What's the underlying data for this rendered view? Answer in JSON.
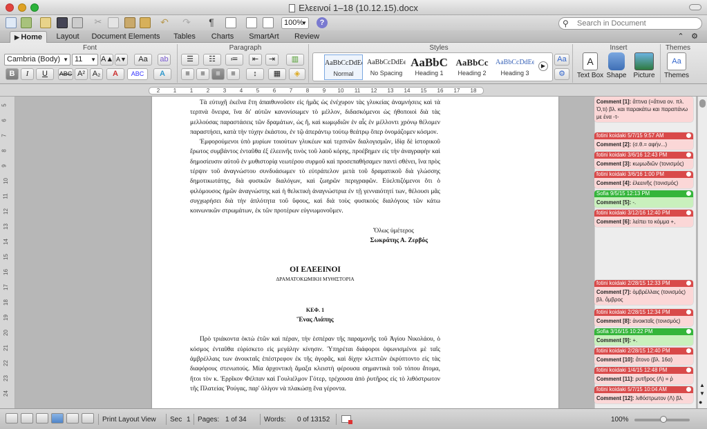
{
  "window": {
    "title": "Ελεεινοί 1–18 (10.12.15).docx"
  },
  "toolbar": {
    "zoom": "100%",
    "search_placeholder": "Search in Document",
    "help": "?"
  },
  "tabs": [
    "Home",
    "Layout",
    "Document Elements",
    "Tables",
    "Charts",
    "SmartArt",
    "Review"
  ],
  "ribbon": {
    "groups": {
      "font": "Font",
      "paragraph": "Paragraph",
      "styles": "Styles",
      "insert": "Insert",
      "themes": "Themes"
    },
    "font_name": "Cambria (Body)",
    "font_size": "11",
    "styles": [
      {
        "preview": "AaBbCcDdEe",
        "label": "Normal"
      },
      {
        "preview": "AaBbCcDdEe",
        "label": "No Spacing"
      },
      {
        "preview": "AaBbC",
        "label": "Heading 1"
      },
      {
        "preview": "AaBbCc",
        "label": "Heading 2"
      },
      {
        "preview": "AaBbCcDdEe",
        "label": "Heading 3"
      }
    ],
    "insert": {
      "text_box": "Text Box",
      "shape": "Shape",
      "picture": "Picture"
    },
    "themes_label": "Themes"
  },
  "ruler": {
    "numbers": [
      "2",
      "1",
      "1",
      "2",
      "3",
      "4",
      "5",
      "6",
      "7",
      "8",
      "9",
      "10",
      "11",
      "12",
      "13",
      "14",
      "15",
      "16",
      "17",
      "18"
    ]
  },
  "vruler": {
    "numbers": [
      "5",
      "6",
      "7",
      "8",
      "9",
      "10",
      "11",
      "12",
      "13",
      "14",
      "15",
      "16",
      "17",
      "18",
      "19",
      "20",
      "21",
      "22",
      "23",
      "24"
    ]
  },
  "document": {
    "p1": "Τὰ εὐτυχῆ ἐκεῖνα ἔτη ἀπαιθυνοῦσιν εἰς ἡμᾶς ὡς ἐνέχυρον τὰς γλυκείας ἀναμνήσεις καὶ τὰ τερπνὰ ὄνειρα, ἵνα δι' αὐτῶν κανονίσωμεν τὸ μέλλον, διδασκόμενοι ὡς ἠθοποιοὶ διὰ τὰς μελλούσας παραστάσεις τῶν δραμάτων, ὡς ἤ, καὶ κωμῳδιῶν ἐν αἷς ἐν μέλλοντι χρόνῳ θέλομεν παραστήσει, κατὰ τὴν τύχην ἑκάστου, ἐν τῷ ἀπεράντῳ τούτῳ θεάτρῳ ὅπερ ὀνομάζομεν κόσμον.",
    "p2": "Ἐμφορούμενοι ὑπὸ μυρίων τοιούτων γλυκέων καὶ τερπνῶν διαλογισμῶν, ἰδίᾳ δὲ ἱστορικοῦ ἔρωτος συμβάντος ἐνταῦθα ἐξ ἐλεεινῆς τινὸς τοῦ λαοῦ κόρης, προέβημεν εἰς τὴν ἀναγραφὴν καὶ δημοσίευσιν αὐτοῦ ἐν μυθιστορίᾳ νεωτέρου συρμοῦ καὶ προσεπαθήσαμεν παντὶ σθένει, ἵνα πρὸς τέρψιν τοῦ ἀναγνώστου συνδυάσωμεν τὸ εὐτράπελον μετὰ τοῦ δραματικοῦ διὰ γλώσσης δημοτικωτάτης, διὰ φυσικῶν διαλόγων, καὶ ζωηρῶν περιγραφῶν. Εὐελπιζόμενοι ὅτι ὁ φιλόμουσος ἡμῶν ἀναγνώστης καὶ ἡ θελκτικὴ ἀναγνώστρια ἐν τῇ γενναιότητί των, θέλουσι μᾶς συγχωρήσει διὰ τὴν ἀπλότητα τοῦ ὕφους, καὶ διὰ τοὺς φυσικοὺς διαλόγους τῶν κάτω κοινωνικῶν στρωμάτων, ἐκ τῶν προτέρων εὐγνωμονοῦμεν.",
    "closing": "Ὅλως ὑμέτερος",
    "author": "Σωκράτης Α. Ζερβός",
    "book_title": "ΟΙ ΕΛΕΕΙΝΟΙ",
    "subtitle": "ΔΡΑΜΑΤΟΚΩΜΙΚΗ ΜΥΘΙΣΤΟΡΙΑ",
    "chapter": "ΚΕΦ. 1",
    "chapter_title": "Ἕνας Λιάπης",
    "p3": "Πρὸ τριάκοντα ὀκτὼ ἐτῶν καὶ πέραν, τὴν ἑσπέραν τῆς παραμονῆς τοῦ Ἁγίου Νικολάου, ὁ κόσμος ἐνταῦθα εὑρίσκετο εἰς μεγάλην κίνησιν. Ὑπηρέται διάφοροι ὀψωνισμένοι μὲ ταῖς ἀμβρέλλαις των ἀνοικταῖς ἐπέστρεφον ἐκ τῆς ἀγορᾶς, καὶ δίχην κλεπτῶν ἐκρύπτοντο εἰς τὰς διαφόρους στενωπούς. Μία ἀρχοντικὴ ἅμαξα κλειστὴ φέρουσα σημαντικὰ τοῦ τόπου ἄτομα, ἤτοι τὸν κ. Ἐρρῖκον Φέλπαν καὶ Γουλιέλμον Γότερ, τρέχουσα ἀπὸ ῥυτῆρος εἰς τὸ λιθόστρωτον τῆς Πλατείας Ῥούγας, παρ' ὀλίγον νὰ πλακώσῃ ἕνα γέροντα."
  },
  "comments": [
    {
      "author": "",
      "label": "Comment [1]:",
      "text": "ἄττινα (=ἅτινα ον. πλ. Ὁ,τι) βλ. και παρακάτω και παραπάνω με ένα -τ-",
      "color": "red"
    },
    {
      "author": "fotini koidaki 5/7/15 9:57 AM",
      "label": "Comment [2]:",
      "text": "(σ.θ.= αφήν...)",
      "color": "red"
    },
    {
      "author": "fotini koidaki 3/6/16 12:43 PM",
      "label": "Comment [3]:",
      "text": "κωμωδιῶν (τονισμός)",
      "color": "red"
    },
    {
      "author": "fotini koidaki 3/6/16 1:00 PM",
      "label": "Comment [4]:",
      "text": "ἐλεεινῆς (τονισμός)",
      "color": "red"
    },
    {
      "author": "Sofia 9/5/15 12:13 PM",
      "label": "Comment [5]:",
      "text": "-.",
      "color": "green"
    },
    {
      "author": "fotini koidaki 3/12/16 12:40 PM",
      "label": "Comment [6]:",
      "text": "λείπει το κόμμα +,",
      "color": "red"
    },
    {
      "author": "fotini koidaki 2/28/15 12:33 PM",
      "label": "Comment [7]:",
      "text": "ὀμβρέλλαις (τονισμός) βλ. ὄμβρος",
      "color": "red"
    },
    {
      "author": "fotini koidaki 2/28/15 12:34 PM",
      "label": "Comment [8]:",
      "text": "ἀνοικταῖς (τονισμός)",
      "color": "red"
    },
    {
      "author": "Sofia 3/16/15 10:22 PM",
      "label": "Comment [9]:",
      "text": "+.",
      "color": "green"
    },
    {
      "author": "fotini koidaki 2/28/15 12:40 PM",
      "label": "Comment [10]:",
      "text": "ἄτονο (βλ. 16α)",
      "color": "red"
    },
    {
      "author": "fotini koidaki 1/4/15 12:48 PM",
      "label": "Comment [11]:",
      "text": "ρυτῆρος (Λ) = ῥ",
      "color": "red"
    },
    {
      "author": "fotini koidaki 5/7/15 10:04 AM",
      "label": "Comment [12]:",
      "text": "λιθόστρωτον (Λ) βλ.",
      "color": "red"
    }
  ],
  "status": {
    "view": "Print Layout View",
    "sec_label": "Sec",
    "sec": "1",
    "pages_label": "Pages:",
    "pages": "1 of 34",
    "words_label": "Words:",
    "words": "0 of 13152",
    "zoom": "100%"
  }
}
